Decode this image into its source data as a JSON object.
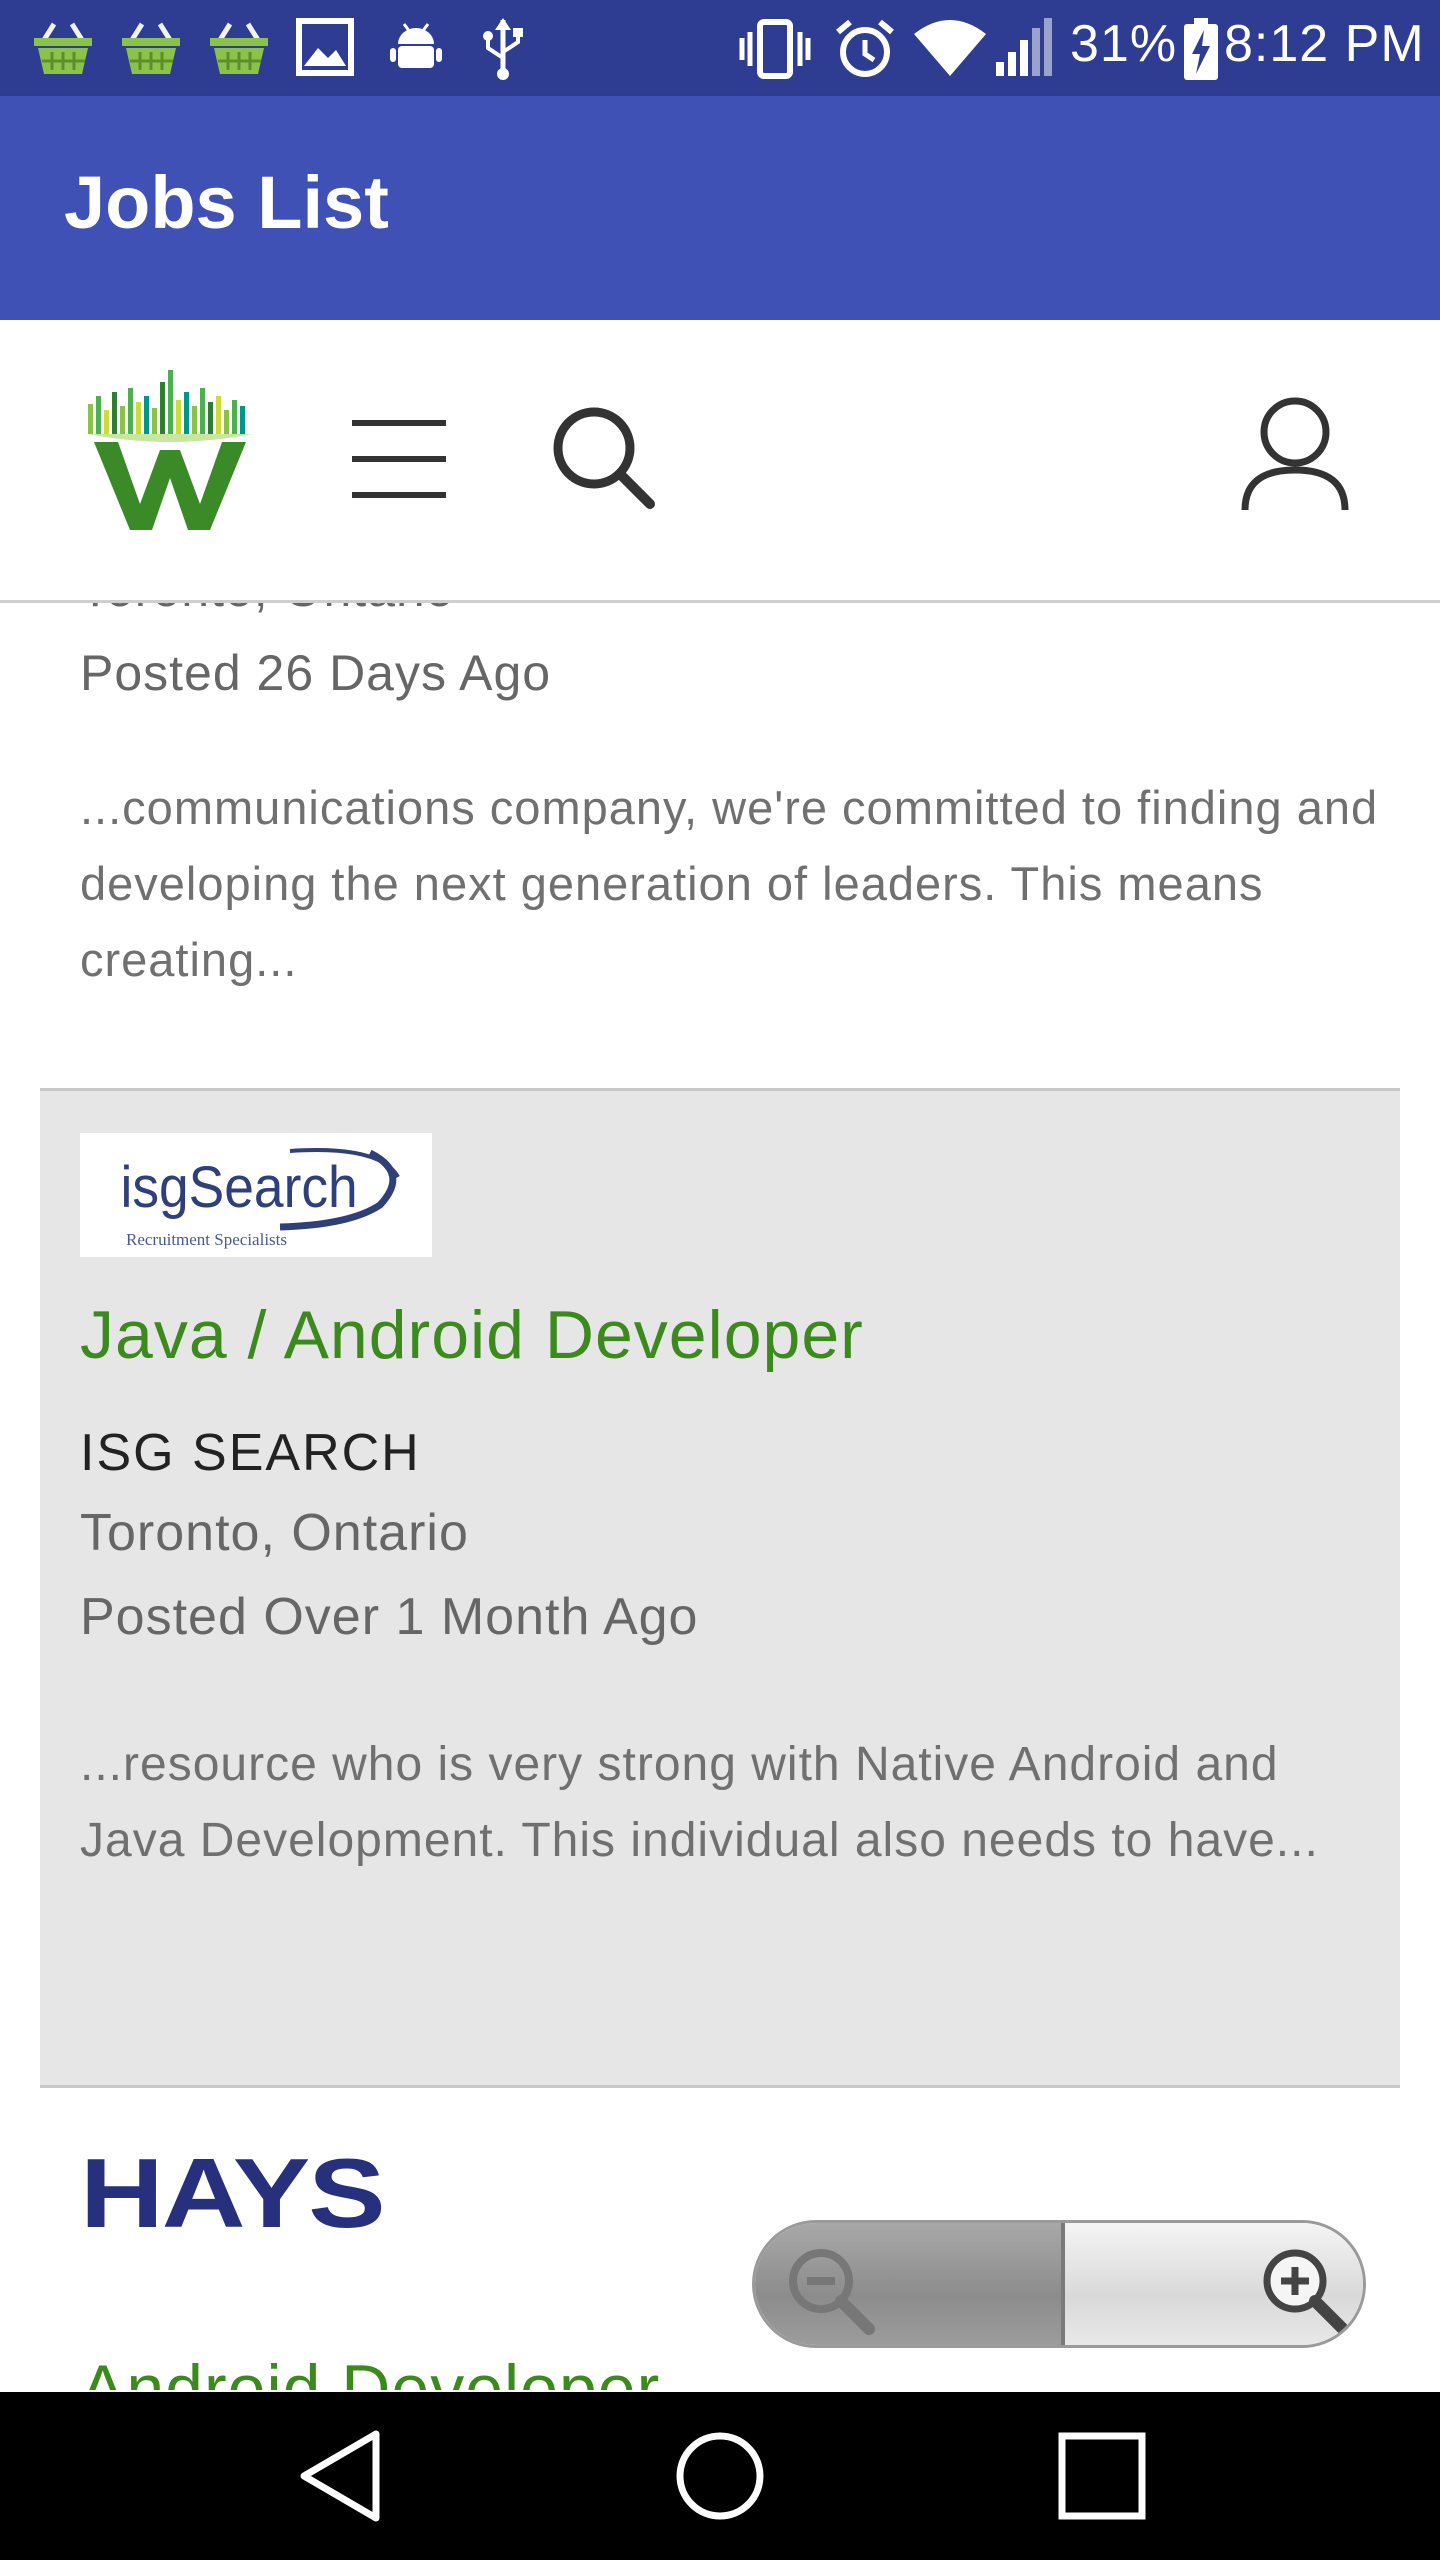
{
  "status_bar": {
    "battery": "31%",
    "time": "8:12 PM",
    "icons": [
      "basket-icon",
      "basket-icon",
      "basket-icon",
      "image-icon",
      "android-debug-icon",
      "usb-icon",
      "vibrate-icon",
      "alarm-icon",
      "wifi-icon",
      "signal-icon",
      "battery-charging-icon"
    ]
  },
  "app_bar": {
    "title": "Jobs List"
  },
  "site_header": {
    "icons": [
      "workopolis-logo",
      "menu-icon",
      "search-icon",
      "account-icon"
    ]
  },
  "listings": [
    {
      "location": "Toronto, Ontario",
      "posted": "Posted 26 Days Ago",
      "snippet": "...communications company, we're committed to finding and developing the next generation of leaders. This means creating..."
    },
    {
      "logo_text": "isgSearch",
      "logo_subtext": "Recruitment Specialists",
      "title": "Java / Android Developer",
      "company": "ISG SEARCH",
      "location": "Toronto, Ontario",
      "posted": "Posted Over 1 Month Ago",
      "snippet": "...resource who is very strong with Native Android and Java Development.  This individual also needs to have..."
    },
    {
      "logo_text": "HAYS",
      "title": "Android Developer"
    }
  ],
  "zoom": {
    "out_icon": "zoom-out-icon",
    "in_icon": "zoom-in-icon"
  },
  "nav_bar": {
    "icons": [
      "back-icon",
      "home-icon",
      "recents-icon"
    ]
  },
  "colors": {
    "status_bar": "#2e3d92",
    "app_bar": "#3f51b5",
    "job_title": "#3c8a1e",
    "hays": "#27307c"
  }
}
